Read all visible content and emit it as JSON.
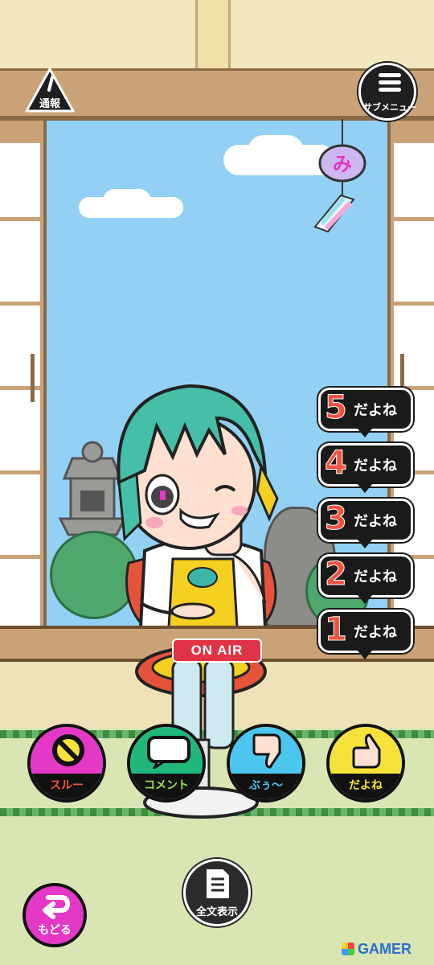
{
  "header": {
    "report_label": "通報",
    "submenu_label": "サブメニュー"
  },
  "wind_chime": {
    "glyph": "み"
  },
  "ratings": [
    {
      "number": "5",
      "label": "だよね"
    },
    {
      "number": "4",
      "label": "だよね"
    },
    {
      "number": "3",
      "label": "だよね"
    },
    {
      "number": "2",
      "label": "だよね"
    },
    {
      "number": "1",
      "label": "だよね"
    }
  ],
  "status": {
    "on_air": "ON AIR"
  },
  "actions": [
    {
      "label": "スルー",
      "label_color": "#f0533f",
      "icon": "no-entry-icon",
      "accent": "#e438c7"
    },
    {
      "label": "コメント",
      "label_color": "#9be34a",
      "icon": "speech-bubble-icon",
      "accent": "#1fb87a"
    },
    {
      "label": "ぶぅ〜",
      "label_color": "#4cc6ef",
      "icon": "thumbs-down-icon",
      "accent": "#4cc6ef"
    },
    {
      "label": "だよね",
      "label_color": "#f5e23a",
      "icon": "thumbs-up-icon",
      "accent": "#f5e23a"
    }
  ],
  "footer": {
    "back_label": "もどる",
    "fulltext_label": "全文表示"
  },
  "watermark": "GAMER"
}
